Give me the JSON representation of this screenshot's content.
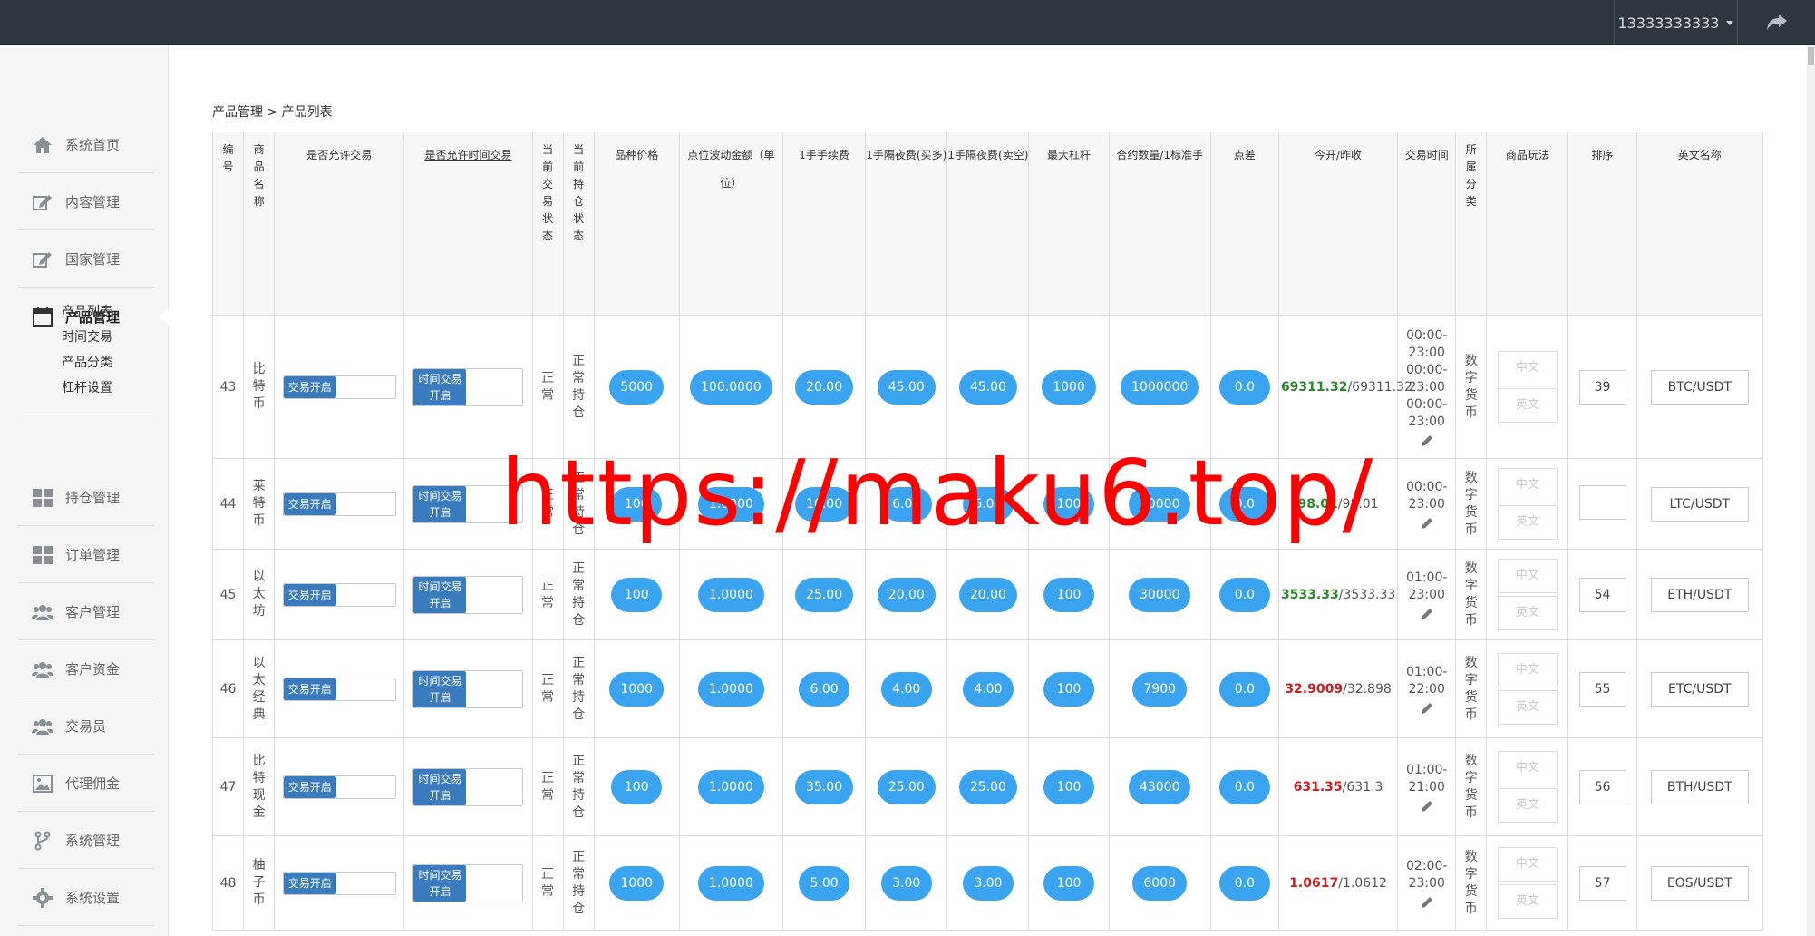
{
  "topbar": {
    "username": "13333333333"
  },
  "sidebar": {
    "items": [
      {
        "label": "系统首页",
        "icon": "home-icon"
      },
      {
        "label": "内容管理",
        "icon": "edit-icon"
      },
      {
        "label": "国家管理",
        "icon": "edit-icon"
      },
      {
        "label": "产品管理",
        "icon": "calendar-icon"
      },
      {
        "label": "持仓管理",
        "icon": "grid-icon"
      },
      {
        "label": "订单管理",
        "icon": "grid-icon"
      },
      {
        "label": "客户管理",
        "icon": "users-icon"
      },
      {
        "label": "客户资金",
        "icon": "users-icon"
      },
      {
        "label": "交易员",
        "icon": "users-icon"
      },
      {
        "label": "代理佣金",
        "icon": "image-icon"
      },
      {
        "label": "系统管理",
        "icon": "branch-icon"
      },
      {
        "label": "系统设置",
        "icon": "gear-icon"
      }
    ],
    "sub_items": [
      "产品列表",
      "时间交易",
      "产品分类",
      "杠杆设置"
    ]
  },
  "breadcrumb": "产品管理 > 产品列表",
  "table": {
    "headers": {
      "id": "编号",
      "name": "商品名称",
      "allow_trade": "是否允许交易",
      "allow_time_trade": "是否允许时间交易",
      "trade_status": "当前交易状态",
      "position_status": "当前持仓状态",
      "price": "品种价格",
      "tick": "点位波动金额（单位）",
      "fee": "1手手续费",
      "overnight_buy": "1手隔夜费(买多)",
      "overnight_sell": "1手隔夜费(卖空)",
      "leverage": "最大杠杆",
      "contract": "合约数量/1标准手",
      "spread": "点差",
      "open_close": "今开/昨收",
      "trade_time": "交易时间",
      "category": "所属分类",
      "play": "商品玩法",
      "sort": "排序",
      "english": "英文名称"
    },
    "toggle_label": "交易开启",
    "time_toggle_label": "时间交易开启",
    "trade_status_text": "正常",
    "position_status_text": "正常持仓",
    "category_text": "数字货币",
    "lang_cn": "中文",
    "lang_en": "英文",
    "rows": [
      {
        "id": "43",
        "name": "比特币",
        "price": "5000",
        "tick": "100.0000",
        "fee": "20.00",
        "ob": "45.00",
        "os": "45.00",
        "lev": "1000",
        "contract": "1000000",
        "spread": "0.0",
        "open": "69311.32",
        "close": "/69311.32",
        "dir": "up",
        "time": [
          "00:00-",
          "23:00",
          "00:00-",
          "23:00",
          "00:00-",
          "23:00"
        ],
        "sort": "39",
        "en": "BTC/USDT"
      },
      {
        "id": "44",
        "name": "莱特币",
        "price": "100",
        "tick": "1.0000",
        "fee": "10.00",
        "ob": "6.00",
        "os": "6.00",
        "lev": "100",
        "contract": "10000",
        "spread": "0.0",
        "open": "98.01",
        "close": "/98.01",
        "dir": "up",
        "time": [
          "00:00-",
          "23:00"
        ],
        "sort": "",
        "en": "LTC/USDT"
      },
      {
        "id": "45",
        "name": "以太坊",
        "price": "100",
        "tick": "1.0000",
        "fee": "25.00",
        "ob": "20.00",
        "os": "20.00",
        "lev": "100",
        "contract": "30000",
        "spread": "0.0",
        "open": "3533.33",
        "close": "/3533.33",
        "dir": "up",
        "time": [
          "01:00-",
          "23:00"
        ],
        "sort": "54",
        "en": "ETH/USDT"
      },
      {
        "id": "46",
        "name": "以太经典",
        "price": "1000",
        "tick": "1.0000",
        "fee": "6.00",
        "ob": "4.00",
        "os": "4.00",
        "lev": "100",
        "contract": "7900",
        "spread": "0.0",
        "open": "32.9009",
        "close": "/32.898",
        "dir": "down",
        "time": [
          "01:00-",
          "22:00"
        ],
        "sort": "55",
        "en": "ETC/USDT"
      },
      {
        "id": "47",
        "name": "比特现金",
        "price": "100",
        "tick": "1.0000",
        "fee": "35.00",
        "ob": "25.00",
        "os": "25.00",
        "lev": "100",
        "contract": "43000",
        "spread": "0.0",
        "open": "631.35",
        "close": "/631.3",
        "dir": "down",
        "time": [
          "01:00-",
          "21:00"
        ],
        "sort": "56",
        "en": "BTH/USDT"
      },
      {
        "id": "48",
        "name": "柚子币",
        "price": "1000",
        "tick": "1.0000",
        "fee": "5.00",
        "ob": "3.00",
        "os": "3.00",
        "lev": "100",
        "contract": "6000",
        "spread": "0.0",
        "open": "1.0617",
        "close": "/1.0612",
        "dir": "down",
        "time": [
          "02:00-",
          "23:00"
        ],
        "sort": "57",
        "en": "EOS/USDT"
      }
    ]
  },
  "watermark": "https://maku6.top/"
}
